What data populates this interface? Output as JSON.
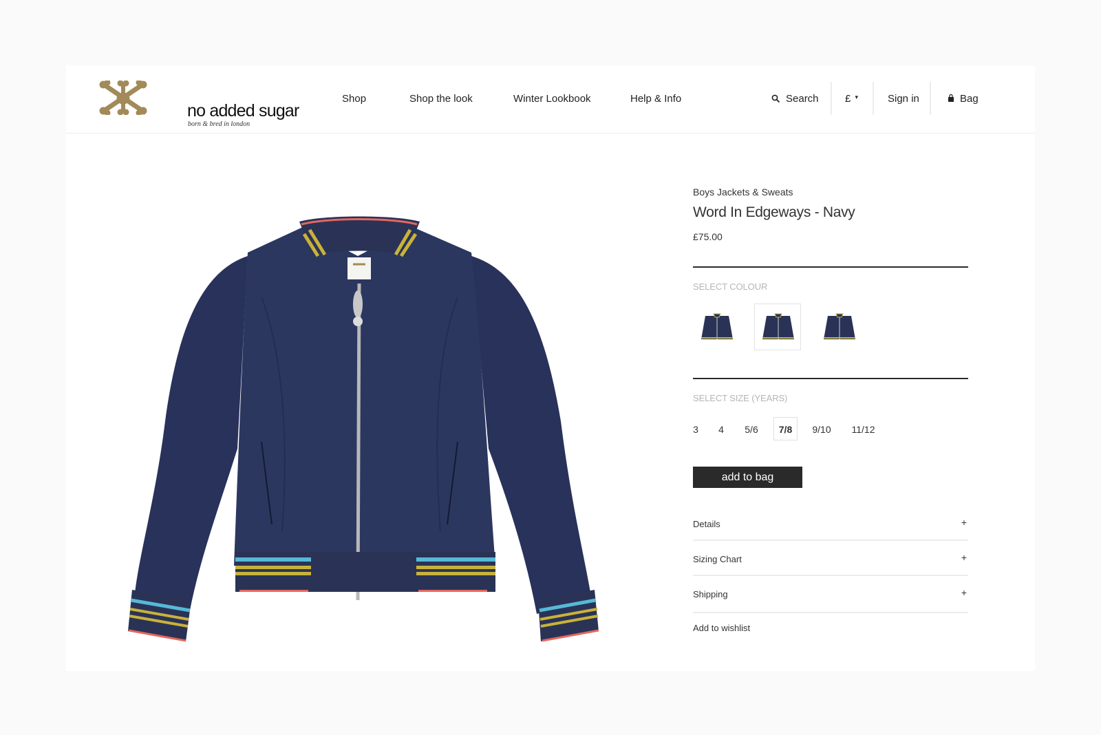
{
  "brand": {
    "name": "no added sugar",
    "tagline": "born & bred in london",
    "logo_color": "#a28a59"
  },
  "nav": {
    "items": [
      "Shop",
      "Shop the look",
      "Winter Lookbook",
      "Help & Info"
    ]
  },
  "utility": {
    "search_label": "Search",
    "currency_label": "£",
    "currency_caret": "▾",
    "signin_label": "Sign in",
    "bag_label": "Bag"
  },
  "product": {
    "category": "Boys Jackets & Sweats",
    "title": "Word In Edgeways - Navy",
    "price": "£75.00",
    "image_icon": "navy-bomber-jacket-image"
  },
  "colour": {
    "label": "SELECT COLOUR",
    "swatches": [
      "navy-jacket-swatch",
      "navy-jacket-swatch",
      "navy-jacket-swatch"
    ],
    "selected_index": 1
  },
  "size": {
    "label": "SELECT SIZE (YEARS)",
    "options": [
      "3",
      "4",
      "5/6",
      "7/8",
      "9/10",
      "11/12"
    ],
    "selected": "7/8"
  },
  "actions": {
    "add_to_bag": "add to bag",
    "wishlist": "Add to wishlist"
  },
  "accordion": [
    {
      "label": "Details",
      "icon": "+"
    },
    {
      "label": "Sizing Chart",
      "icon": "+"
    },
    {
      "label": "Shipping",
      "icon": "+"
    }
  ],
  "colors": {
    "page_bg": "#fafafa",
    "panel_bg": "#ffffff",
    "jacket_navy": "#2a3356",
    "rib_yellow": "#c9b23a",
    "rib_cyan": "#56b9d7",
    "rib_red": "#e5675e",
    "button_bg": "#2a2a2a"
  }
}
